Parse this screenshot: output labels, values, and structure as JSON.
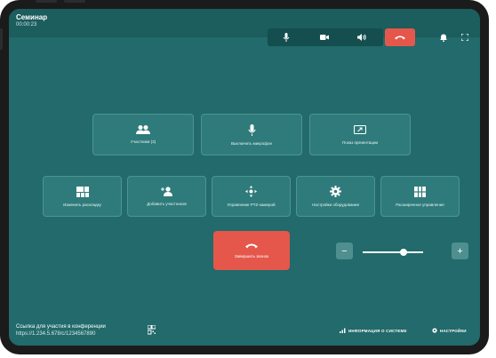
{
  "header": {
    "title": "Семинар",
    "timer": "00:00:23"
  },
  "actions_row1": [
    {
      "label": "Участники (3)",
      "icon": "users-icon"
    },
    {
      "label": "Выключить микрофон",
      "icon": "microphone-icon"
    },
    {
      "label": "Показ презентации",
      "icon": "screen-share-icon"
    }
  ],
  "actions_row2": [
    {
      "label": "Изменить раскладку",
      "icon": "layout-icon"
    },
    {
      "label": "Добавить участников",
      "icon": "add-user-icon"
    },
    {
      "label": "Управление PTZ-камерой",
      "icon": "ptz-icon"
    },
    {
      "label": "Настройки оборудования",
      "icon": "gear-icon"
    },
    {
      "label": "Расширенное управление",
      "icon": "grid-icon"
    }
  ],
  "end_call": {
    "label": "Завершить звонок"
  },
  "volume": {
    "minus": "−",
    "plus": "+",
    "level": 0.62
  },
  "footer": {
    "link_label": "Ссылка для участия в конференции",
    "link_url": "https://1.234.5.678/c/1234567890",
    "system_info": "ИНФОРМАЦИЯ О СИСТЕМЕ",
    "settings": "НАСТРОЙКИ"
  }
}
